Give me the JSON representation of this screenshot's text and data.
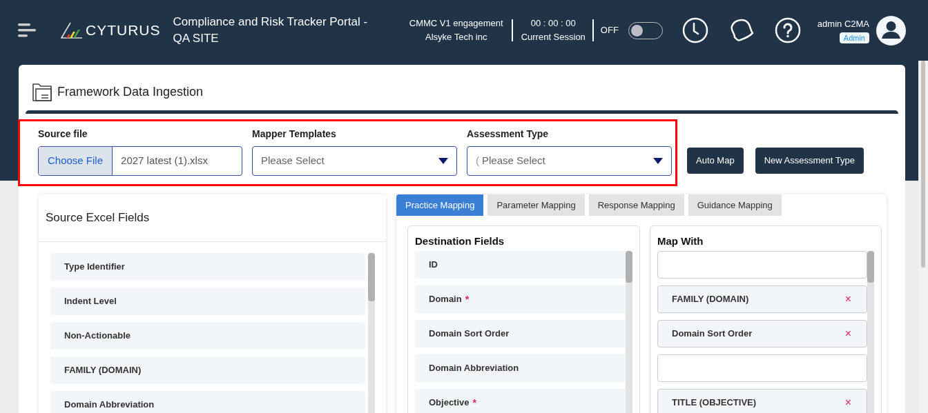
{
  "header": {
    "logo": "CYTURUS",
    "title": "Compliance and Risk Tracker Portal - QA SITE",
    "engagement": {
      "name": "CMMC V1 engagement",
      "company": "Alsyke Tech inc"
    },
    "session": {
      "timer": "00 : 00 : 00",
      "label": "Current Session"
    },
    "toggle": {
      "label": "OFF",
      "on": false
    },
    "user": {
      "name": "admin C2MA",
      "role": "Admin"
    }
  },
  "page": {
    "title": "Framework Data Ingestion"
  },
  "form": {
    "source_file": {
      "label": "Source file",
      "button": "Choose File",
      "value": "2027 latest (1).xlsx"
    },
    "mapper_templates": {
      "label": "Mapper Templates",
      "placeholder": "Please Select"
    },
    "assessment_type": {
      "label": "Assessment Type",
      "prefix": "(",
      "placeholder": "Please Select"
    },
    "buttons": [
      "Auto Map",
      "New Assessment Type"
    ]
  },
  "source_fields": {
    "title": "Source Excel Fields",
    "items": [
      "Type Identifier",
      "Indent Level",
      "Non-Actionable",
      "FAMILY (DOMAIN)",
      "Domain Abbreviation"
    ]
  },
  "tabs": [
    {
      "label": "Practice Mapping",
      "selected": true
    },
    {
      "label": "Parameter Mapping",
      "selected": false
    },
    {
      "label": "Response Mapping",
      "selected": false
    },
    {
      "label": "Guidance Mapping",
      "selected": false
    }
  ],
  "destination_fields": {
    "title": "Destination Fields",
    "items": [
      {
        "label": "ID"
      },
      {
        "label": "Domain",
        "required_mark": "*"
      },
      {
        "label": "Domain Sort Order"
      },
      {
        "label": "Domain Abbreviation"
      },
      {
        "label": "Objective",
        "required_mark": "*"
      }
    ]
  },
  "map_with": {
    "title": "Map With",
    "items": [
      {
        "kind": "empty"
      },
      {
        "kind": "value",
        "label": "FAMILY (DOMAIN)",
        "remove": "×"
      },
      {
        "kind": "value",
        "label": "Domain Sort Order",
        "remove": "×"
      },
      {
        "kind": "empty"
      },
      {
        "kind": "value",
        "label": "TITLE (OBJECTIVE)",
        "remove": "×"
      }
    ]
  }
}
